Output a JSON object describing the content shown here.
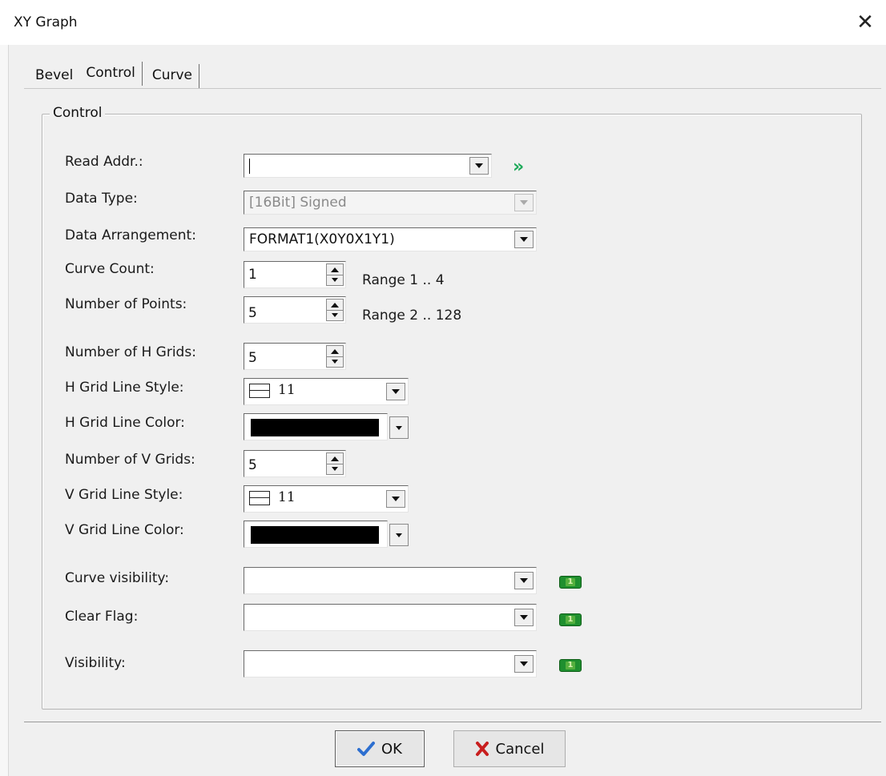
{
  "window": {
    "title": "XY Graph",
    "close_glyph": "✕"
  },
  "tabs": [
    {
      "label": "Bevel"
    },
    {
      "label": "Control",
      "active": true
    },
    {
      "label": "Curve"
    }
  ],
  "group": {
    "legend": "Control"
  },
  "fields": {
    "read_addr": {
      "label": "Read Addr.:",
      "value": ""
    },
    "data_type": {
      "label": "Data Type:",
      "value": "[16Bit] Signed",
      "disabled": true
    },
    "data_arrangement": {
      "label": "Data Arrangement:",
      "value": "FORMAT1(X0Y0X1Y1)"
    },
    "curve_count": {
      "label": "Curve Count:",
      "value": "1",
      "range": "Range 1 .. 4"
    },
    "number_of_points": {
      "label": "Number of Points:",
      "value": "5",
      "range": "Range 2 .. 128"
    },
    "number_of_h_grids": {
      "label": "Number of H Grids:",
      "value": "5"
    },
    "h_grid_line_style": {
      "label": "H Grid Line Style:",
      "value": "11"
    },
    "h_grid_line_color": {
      "label": "H Grid Line Color:",
      "color": "#000000"
    },
    "number_of_v_grids": {
      "label": "Number of V Grids:",
      "value": "5"
    },
    "v_grid_line_style": {
      "label": "V Grid Line Style:",
      "value": "11"
    },
    "v_grid_line_color": {
      "label": "V Grid Line Color:",
      "color": "#000000"
    },
    "curve_visibility": {
      "label": "Curve visibility:",
      "value": "",
      "badge": "1"
    },
    "clear_flag": {
      "label": "Clear Flag:",
      "value": "",
      "badge": "1"
    },
    "visibility": {
      "label": "Visibility:",
      "value": "",
      "badge": "1"
    }
  },
  "icons": {
    "address_picker": "double-chevron-right-icon",
    "ok": "checkmark-icon",
    "cancel": "red-x-icon"
  },
  "buttons": {
    "ok": "OK",
    "cancel": "Cancel"
  },
  "colors": {
    "chevron_green": "#1eaa5a",
    "badge_green": "#1f8f2f",
    "check_blue": "#2d6fd0",
    "cancel_red": "#c81e1e"
  }
}
